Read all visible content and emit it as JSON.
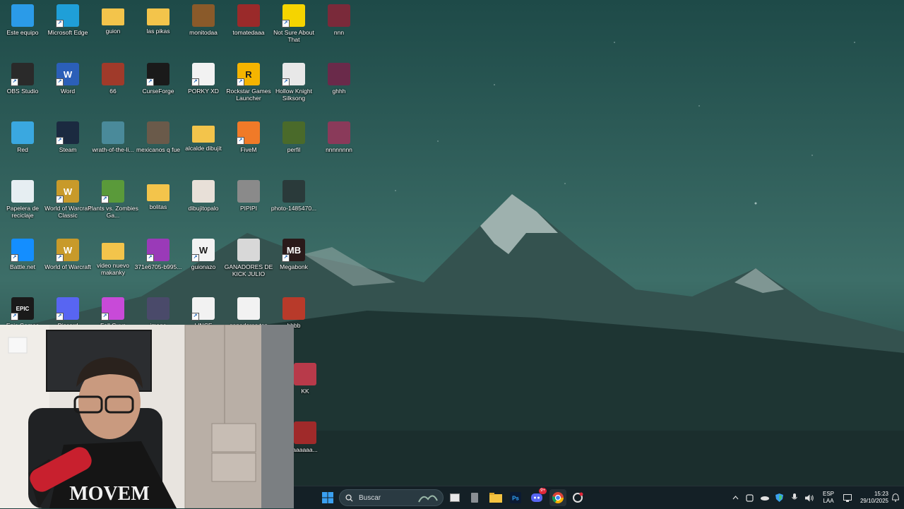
{
  "desktop": {
    "icons": [
      {
        "label": "Este equipo",
        "icon": "computer-icon",
        "color": "#2b9be8"
      },
      {
        "label": "Microsoft Edge",
        "icon": "edge-icon",
        "color": "#1f9fd8"
      },
      {
        "label": "guion",
        "icon": "folder-icon",
        "color": "#f3c44b"
      },
      {
        "label": "las pikas",
        "icon": "folder-icon",
        "color": "#f3c44b"
      },
      {
        "label": "monitodaa",
        "icon": "image-icon",
        "color": "#8a5a2a"
      },
      {
        "label": "tomatedaaa",
        "icon": "image-icon",
        "color": "#9a2a2a"
      },
      {
        "label": "Not Sure About That",
        "icon": "duck-icon",
        "color": "#f5d400"
      },
      {
        "label": "nnn",
        "icon": "image-icon",
        "color": "#7a2a3a"
      },
      {
        "label": "OBS Studio",
        "icon": "obs-icon",
        "color": "#2a2a2a"
      },
      {
        "label": "Word",
        "icon": "word-icon",
        "color": "#2b5fb8",
        "glyph": "W"
      },
      {
        "label": "66",
        "icon": "image-icon",
        "color": "#a03a2a"
      },
      {
        "label": "CurseForge",
        "icon": "curseforge-icon",
        "color": "#1a1a1a"
      },
      {
        "label": "PORKY XD",
        "icon": "video-icon",
        "color": "#f2f2f2"
      },
      {
        "label": "Rockstar Games Launcher",
        "icon": "rockstar-icon",
        "color": "#f5b400",
        "glyph": "R"
      },
      {
        "label": "Hollow Knight Silksong",
        "icon": "hollow-knight-icon",
        "color": "#e8e8e8"
      },
      {
        "label": "ghhh",
        "icon": "image-icon",
        "color": "#6a2a4a"
      },
      {
        "label": "Red",
        "icon": "network-icon",
        "color": "#3aa8e0"
      },
      {
        "label": "Steam",
        "icon": "steam-icon",
        "color": "#1b2a40"
      },
      {
        "label": "wrath-of-the-li...",
        "icon": "image-icon",
        "color": "#4a8a9a"
      },
      {
        "label": "mexicanos q fue",
        "icon": "image-icon",
        "color": "#6a5a4a"
      },
      {
        "label": "alcalde dibujit",
        "icon": "folder-icon",
        "color": "#f3c44b"
      },
      {
        "label": "FiveM",
        "icon": "fivem-icon",
        "color": "#f07a28"
      },
      {
        "label": "perfil",
        "icon": "image-icon",
        "color": "#4a6a2a"
      },
      {
        "label": "nnnnnnnn",
        "icon": "image-icon",
        "color": "#8a3a5a"
      },
      {
        "label": "Papelera de reciclaje",
        "icon": "recycle-bin-icon",
        "color": "#e6eef2"
      },
      {
        "label": "World of Warcraft Classic",
        "icon": "wow-icon",
        "color": "#c89a2a",
        "glyph": "W"
      },
      {
        "label": "Plants vs. Zombies Ga...",
        "icon": "pvz-icon",
        "color": "#5a9a3a"
      },
      {
        "label": "bolitas",
        "icon": "folder-icon",
        "color": "#f3c44b"
      },
      {
        "label": "dibujitopalo",
        "icon": "image-icon",
        "color": "#e8e0d8"
      },
      {
        "label": "PIPIPI",
        "icon": "image-icon",
        "color": "#8a8a8a"
      },
      {
        "label": "photo-1485470...",
        "icon": "image-icon",
        "color": "#2a3a3a"
      },
      {
        "label": "",
        "icon": "",
        "color": ""
      },
      {
        "label": "Battle.net",
        "icon": "battlenet-icon",
        "color": "#148eff"
      },
      {
        "label": "World of Warcraft",
        "icon": "wow-icon",
        "color": "#c89a2a",
        "glyph": "W"
      },
      {
        "label": "video nuevo makanky",
        "icon": "folder-icon",
        "color": "#f3c44b"
      },
      {
        "label": "371e6705-b995...",
        "icon": "file-icon",
        "color": "#9a3ab8"
      },
      {
        "label": "guionazo",
        "icon": "word-doc-icon",
        "color": "#f2f2f2",
        "glyph": "W"
      },
      {
        "label": "GANADORES DE KICK JULIO",
        "icon": "image-icon",
        "color": "#d8d8d8"
      },
      {
        "label": "Megabonk",
        "icon": "megabonk-icon",
        "color": "#2a1a1a",
        "glyph": "MB"
      },
      {
        "label": "",
        "icon": "",
        "color": ""
      },
      {
        "label": "Epic Games",
        "icon": "epic-icon",
        "color": "#1a1a1a",
        "glyph": "EPIC"
      },
      {
        "label": "Discord",
        "icon": "discord-icon",
        "color": "#5865f2"
      },
      {
        "label": "Fall Guys",
        "icon": "fallguys-icon",
        "color": "#c84ad8"
      },
      {
        "label": "image",
        "icon": "image-icon",
        "color": "#4a4a6a"
      },
      {
        "label": "LINCE",
        "icon": "video-icon",
        "color": "#f2f2f2"
      },
      {
        "label": "ganadores top",
        "icon": "image-icon",
        "color": "#f2f2f2"
      },
      {
        "label": "bbbb",
        "icon": "image-icon",
        "color": "#b83a2a"
      },
      {
        "label": "",
        "icon": "",
        "color": ""
      }
    ],
    "partial_icons": [
      {
        "label": "KK"
      },
      {
        "label": "aaaaaa..."
      }
    ]
  },
  "webcam": {
    "shirt_text": "MOVEM"
  },
  "taskbar": {
    "search_placeholder": "Buscar",
    "language_line1": "ESP",
    "language_line2": "LAA",
    "time": "15:23",
    "date": "29/10/2025",
    "discord_badge": "9+"
  }
}
